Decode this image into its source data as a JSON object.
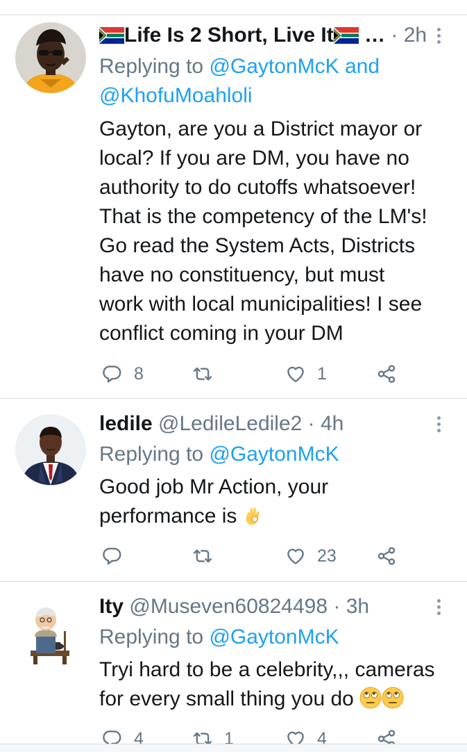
{
  "tweets": [
    {
      "display_name": "Life Is 2 Short, Live It",
      "ellipsis": "…",
      "time": "· 2h",
      "reply_prefix": "Replying to ",
      "reply_mention_1": "@GaytonMcK",
      "reply_and": " and",
      "reply_mention_2": "@KhofuMoahloli",
      "lines": [
        "Gayton, are you a District mayor or",
        "local? If you are DM, you have no",
        "authority to do cutoffs whatsoever!",
        "That is the competency of the LM's!",
        "Go read the System Acts, Districts",
        "have no constituency, but must",
        "work with local municipalities! I see",
        "conflict coming in your DM"
      ],
      "replies": "8",
      "retweets": "",
      "likes": "1"
    },
    {
      "display_name": "ledile",
      "handle": "@LedileLedile2",
      "time": "· 4h",
      "reply_prefix": "Replying to ",
      "reply_mention_1": "@GaytonMcK",
      "lines": [
        "Good job Mr Action, your",
        "performance is"
      ],
      "replies": "",
      "retweets": "",
      "likes": "23"
    },
    {
      "display_name": "Ity",
      "handle": "@Museven60824498",
      "time": "· 3h",
      "reply_prefix": "Replying to ",
      "reply_mention_1": "@GaytonMcK",
      "lines": [
        "Tryi hard to be a celebrity,,, cameras",
        "for every small thing you do"
      ],
      "replies": "4",
      "retweets": "1",
      "likes": "4"
    }
  ],
  "colors": {
    "text": "#14171a",
    "secondary": "#657786",
    "link": "#1da1f2",
    "divider": "#d9dde1"
  },
  "icons": {
    "reply": "reply-icon",
    "retweet": "retweet-icon",
    "like": "heart-icon",
    "share": "share-icon",
    "more": "more-vertical-icon",
    "flag": "south-africa-flag-icon",
    "ok_hand": "ok-hand-emoji",
    "eye_roll": "eye-roll-emoji"
  }
}
